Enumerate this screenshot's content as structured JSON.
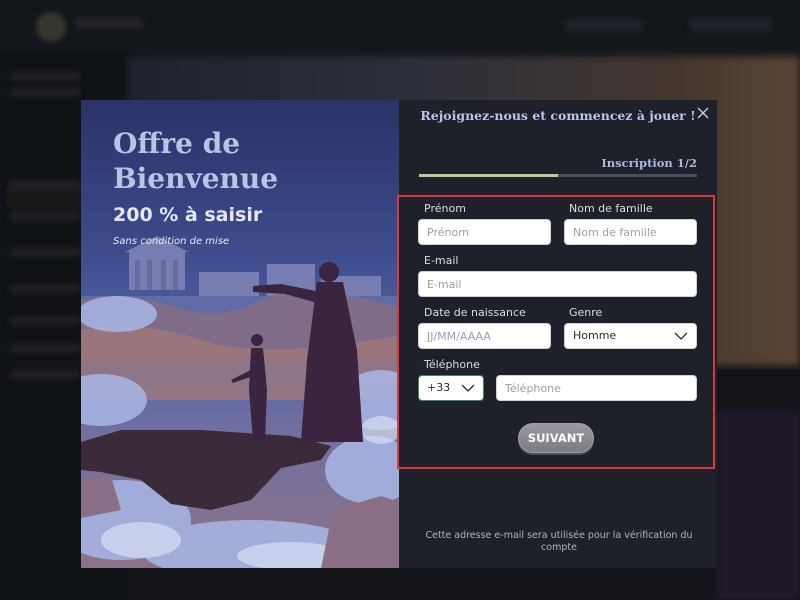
{
  "modal": {
    "promo": {
      "title_line1": "Offre de",
      "title_line2": "Bienvenue",
      "subtitle": "200 % à saisir",
      "note": "Sans condition de mise"
    },
    "header": {
      "title": "Rejoignez-nous et commencez à jouer !",
      "close_icon": "close-icon",
      "step": "Inscription 1/2",
      "progress": 0.5
    },
    "form": {
      "first_name": {
        "label": "Prénom",
        "placeholder": "Prénom",
        "value": ""
      },
      "last_name": {
        "label": "Nom de famille",
        "placeholder": "Nom de famille",
        "value": ""
      },
      "email": {
        "label": "E-mail",
        "placeholder": "E-mail",
        "value": ""
      },
      "birthdate": {
        "label": "Date de naissance",
        "placeholder": "JJ/MM/AAAA",
        "value": ""
      },
      "gender": {
        "label": "Genre",
        "selected": "Homme",
        "icon": "chevron-down-icon"
      },
      "phone": {
        "label": "Téléphone",
        "country_code": "+33",
        "placeholder": "Téléphone",
        "value": ""
      },
      "submit_label": "SUIVANT"
    },
    "footnote": "Cette adresse e-mail sera utilisée pour la vérification du compte"
  },
  "colors": {
    "highlight_border": "#d63a3a",
    "panel_bg": "#1e2129",
    "title": "#b8c6ec",
    "progress_fill": "#c3c996"
  }
}
